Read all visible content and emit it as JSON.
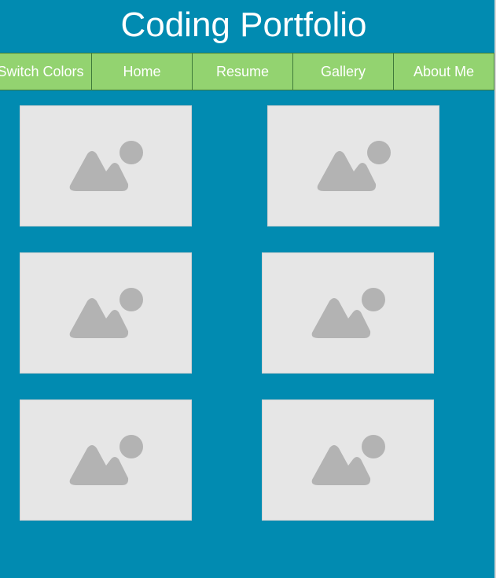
{
  "header": {
    "title": "Coding Portfolio"
  },
  "nav": {
    "items": [
      {
        "label": "Switch Colors"
      },
      {
        "label": "Home"
      },
      {
        "label": "Resume"
      },
      {
        "label": "Gallery"
      },
      {
        "label": "About Me"
      }
    ]
  },
  "gallery": {
    "images": [
      {
        "icon": "image-placeholder-icon"
      },
      {
        "icon": "image-placeholder-icon"
      },
      {
        "icon": "image-placeholder-icon"
      },
      {
        "icon": "image-placeholder-icon"
      },
      {
        "icon": "image-placeholder-icon"
      },
      {
        "icon": "image-placeholder-icon"
      }
    ]
  },
  "colors": {
    "background": "#018bb1",
    "nav_background": "#93d370",
    "placeholder_background": "#e6e6e6",
    "placeholder_icon": "#b3b3b3",
    "text": "#ffffff"
  }
}
